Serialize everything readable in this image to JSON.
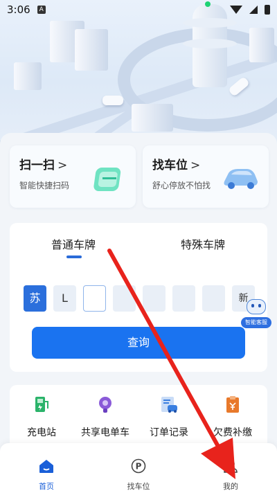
{
  "status_bar": {
    "time": "3:06",
    "notification_badge": "A"
  },
  "quick_actions": [
    {
      "title": "扫一扫",
      "chevron": ">",
      "subtitle": "智能快捷扫码",
      "icon": "scan-card-icon"
    },
    {
      "title": "找车位",
      "chevron": ">",
      "subtitle": "舒心停放不怕找",
      "icon": "car-icon"
    }
  ],
  "plate_tabs": [
    {
      "label": "普通车牌",
      "active": true
    },
    {
      "label": "特殊车牌",
      "active": false
    }
  ],
  "plate_input": {
    "province": "苏",
    "cells": [
      "L",
      "",
      "",
      "",
      "",
      ""
    ],
    "new_energy_label": "新",
    "active_index": 2
  },
  "query_button": {
    "label": "查询"
  },
  "assistant": {
    "label": "智能客服"
  },
  "services": [
    {
      "label": "充电站",
      "icon": "charging-station-icon",
      "color": "#2bb36a"
    },
    {
      "label": "共享电单车",
      "icon": "scooter-icon",
      "color": "#8a5ad8"
    },
    {
      "label": "订单记录",
      "icon": "order-record-icon",
      "color": "#3a7fe0"
    },
    {
      "label": "欠费补缴",
      "icon": "arrears-payment-icon",
      "color": "#e8792b"
    }
  ],
  "bottom_nav": [
    {
      "label": "首页",
      "icon": "home-icon",
      "active": true
    },
    {
      "label": "找车位",
      "icon": "parking-icon",
      "active": false
    },
    {
      "label": "我的",
      "icon": "profile-icon",
      "active": false
    }
  ],
  "colors": {
    "primary": "#1a73f0",
    "annotation_arrow": "#e8231c"
  }
}
